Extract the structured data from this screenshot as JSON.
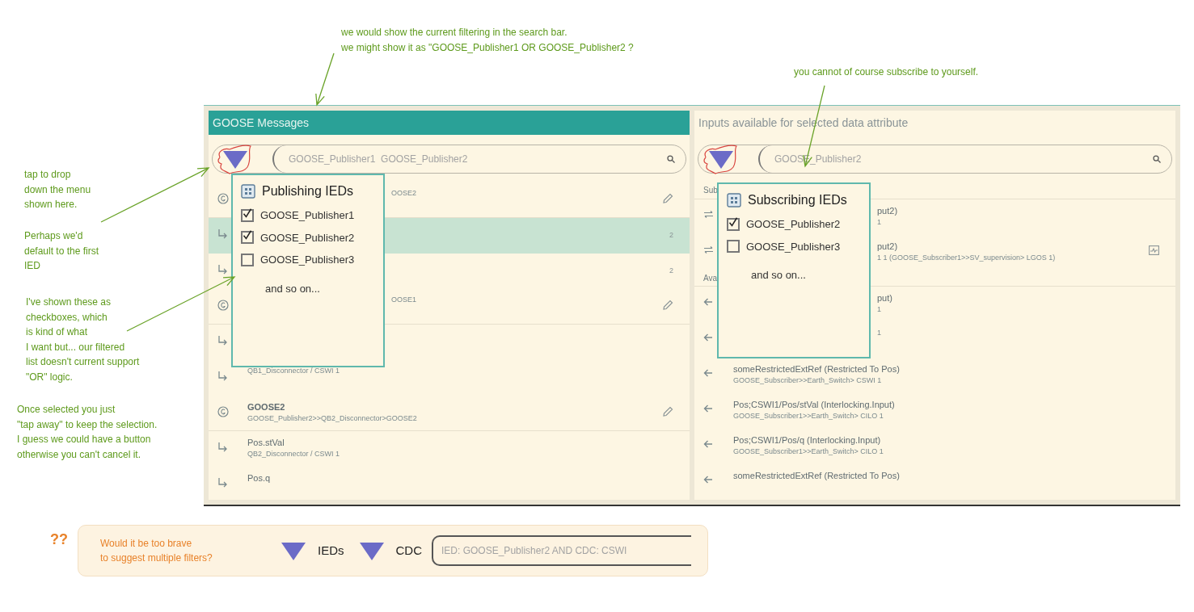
{
  "notes": [
    {
      "text": "we would show the current filtering in the search bar.\nwe might show it as \"GOOSE_Publisher1 OR GOOSE_Publisher2 ?"
    },
    {
      "text": "you cannot of course subscribe to yourself."
    },
    {
      "text": "tap to drop\ndown the menu\nshown here."
    },
    {
      "text": "Perhaps we'd\ndefault to the first\nIED"
    },
    {
      "text": "I've shown these as\ncheckboxes, which\nis kind of what\nI want but... our filtered\nlist doesn't current support\n\"OR\" logic."
    },
    {
      "text": "Once selected you just\n\"tap away\" to keep the selection.\nI guess we could have a button\notherwise you can't cancel it."
    }
  ],
  "left_panel": {
    "title": "GOOSE Messages",
    "search": {
      "value": "GOOSE_Publisher1  GOOSE_Publisher2"
    },
    "dropdown": {
      "title": "Publishing IEDs",
      "options": [
        {
          "label": "GOOSE_Publisher1",
          "checked": true
        },
        {
          "label": "GOOSE_Publisher2",
          "checked": true
        },
        {
          "label": "GOOSE_Publisher3",
          "checked": false
        }
      ],
      "more": "and so on..."
    },
    "rows": [
      {
        "kind": "group",
        "covered": true,
        "selected": false,
        "subtitle": "OOSE2",
        "editable": true
      },
      {
        "kind": "item",
        "selected": true,
        "count": "2"
      },
      {
        "kind": "item",
        "selected": false,
        "count": "2"
      },
      {
        "kind": "group",
        "covered": true,
        "selected": false,
        "subtitle": "OOSE1",
        "editable": true
      },
      {
        "kind": "item",
        "selected": false
      },
      {
        "kind": "item",
        "covered": false,
        "selected": false,
        "subtitle": "QB1_Disconnector / CSWI 1"
      },
      {
        "kind": "group",
        "covered": false,
        "selected": false,
        "title": "GOOSE2",
        "subtitle": "GOOSE_Publisher2>>QB2_Disconnector>GOOSE2",
        "editable": true
      },
      {
        "kind": "item",
        "covered": false,
        "selected": false,
        "title": "Pos.stVal",
        "subtitle": "QB2_Disconnector / CSWI 1"
      },
      {
        "kind": "item",
        "covered": false,
        "selected": false,
        "title": "Pos.q"
      }
    ]
  },
  "right_panel": {
    "title": "Inputs available for selected data attribute",
    "search": {
      "value": "GOOSE_Publisher2"
    },
    "dropdown": {
      "title": "Subscribing IEDs",
      "options": [
        {
          "label": "GOOSE_Publisher2",
          "checked": true
        },
        {
          "label": "GOOSE_Publisher3",
          "checked": false
        }
      ],
      "more": "and so on..."
    },
    "rows": [
      {
        "kind": "section",
        "title": "Sub"
      },
      {
        "kind": "input",
        "covered": true,
        "title": "put2)",
        "subtitle": "1"
      },
      {
        "kind": "input",
        "covered": true,
        "title": "put2)",
        "subtitle": "1 1 (GOOSE_Subscriber1>>SV_supervision> LGOS 1)",
        "chart": true
      },
      {
        "kind": "section",
        "title": "Ava"
      },
      {
        "kind": "available",
        "covered": true,
        "title": "put)",
        "subtitle": "1"
      },
      {
        "kind": "available",
        "covered": true,
        "subtitle": "1"
      },
      {
        "kind": "available",
        "covered": false,
        "title": "someRestrictedExtRef (Restricted To Pos)",
        "subtitle": "GOOSE_Subscriber>>Earth_Switch> CSWI 1"
      },
      {
        "kind": "available",
        "covered": false,
        "title": "Pos;CSWI1/Pos/stVal (Interlocking.Input)",
        "subtitle": "GOOSE_Subscriber1>>Earth_Switch> CILO 1"
      },
      {
        "kind": "available",
        "covered": false,
        "title": "Pos;CSWI1/Pos/q (Interlocking.Input)",
        "subtitle": "GOOSE_Subscriber1>>Earth_Switch> CILO 1"
      },
      {
        "kind": "available",
        "covered": false,
        "title": "someRestrictedExtRef (Restricted To Pos)"
      }
    ]
  },
  "suggestion": {
    "marks": "??",
    "text": "Would it be too brave\nto suggest multiple filters?",
    "filters": [
      "IEDs",
      "CDC"
    ],
    "search": {
      "value": "IED: GOOSE_Publisher2 AND CDC: CSWI"
    }
  }
}
